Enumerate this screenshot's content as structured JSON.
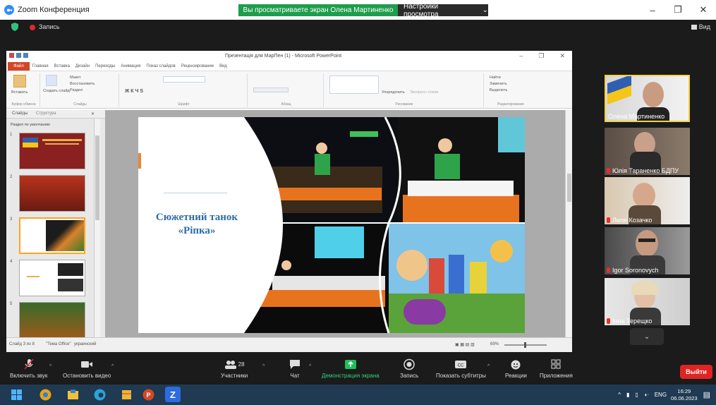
{
  "zoom": {
    "window_title": "Zoom Конференция",
    "share_banner": "Вы просматриваете экран Олена Мартиненко",
    "view_options": "Настройки просмотра",
    "recording_label": "Запись",
    "view_label": "Вид"
  },
  "powerpoint": {
    "doc_title": "Презентація для МарПен (1) - Microsoft PowerPoint",
    "file_tab": "Файл",
    "tabs": [
      "Главная",
      "Вставка",
      "Дизайн",
      "Переходы",
      "Анимация",
      "Показ слайдов",
      "Рецензирование",
      "Вид"
    ],
    "ribbon_groups": [
      "Буфер обмена",
      "Слайды",
      "Шрифт",
      "Абзац",
      "Рисование",
      "Редактирование"
    ],
    "ribbon_labels": {
      "paste": "Вставить",
      "new_slide": "Создать слайд",
      "layout": "Макет",
      "restore": "Восстановить",
      "section": "Раздел",
      "arrange": "Упорядочить",
      "quick_styles": "Экспресс-стили",
      "find": "Найти",
      "replace": "Заменить",
      "select": "Выделить"
    },
    "pane_tabs": [
      "Слайды",
      "Структура"
    ],
    "section_title": "Раздел по умолчанию",
    "thumb_numbers": [
      "1",
      "2",
      "3",
      "4",
      "5"
    ],
    "slide_title": "Сюжетний танок «Ріпка»",
    "status_left": "Слайд 3 из 8",
    "status_theme": "\"Тема Office\"",
    "status_lang": "украинский",
    "zoom_percent": "69%"
  },
  "participants": [
    {
      "name": "Олена Мартиненко",
      "muted": false,
      "active": true
    },
    {
      "name": "Юлія Тараненко БДПУ",
      "muted": true,
      "active": false
    },
    {
      "name": "Лиля Козачко",
      "muted": true,
      "active": false
    },
    {
      "name": "Igor Soronovych",
      "muted": true,
      "active": false
    },
    {
      "name": "Інна Терещко",
      "muted": true,
      "active": false
    }
  ],
  "toolbar": {
    "unmute": "Включить звук",
    "start_video": "Остановить видео",
    "participants": "Участники",
    "participants_count": "28",
    "chat": "Чат",
    "share": "Демонстрация экрана",
    "record": "Запись",
    "captions": "Показать субтитры",
    "reactions": "Реакции",
    "apps": "Приложения",
    "leave": "Выйти"
  },
  "taskbar": {
    "language": "ENG",
    "time": "16:29",
    "date": "06.06.2023"
  },
  "colors": {
    "share_green": "#1e9d4c",
    "leave_red": "#e02424",
    "slide_title_blue": "#2c6ea5",
    "active_speaker_border": "#f7d046"
  }
}
